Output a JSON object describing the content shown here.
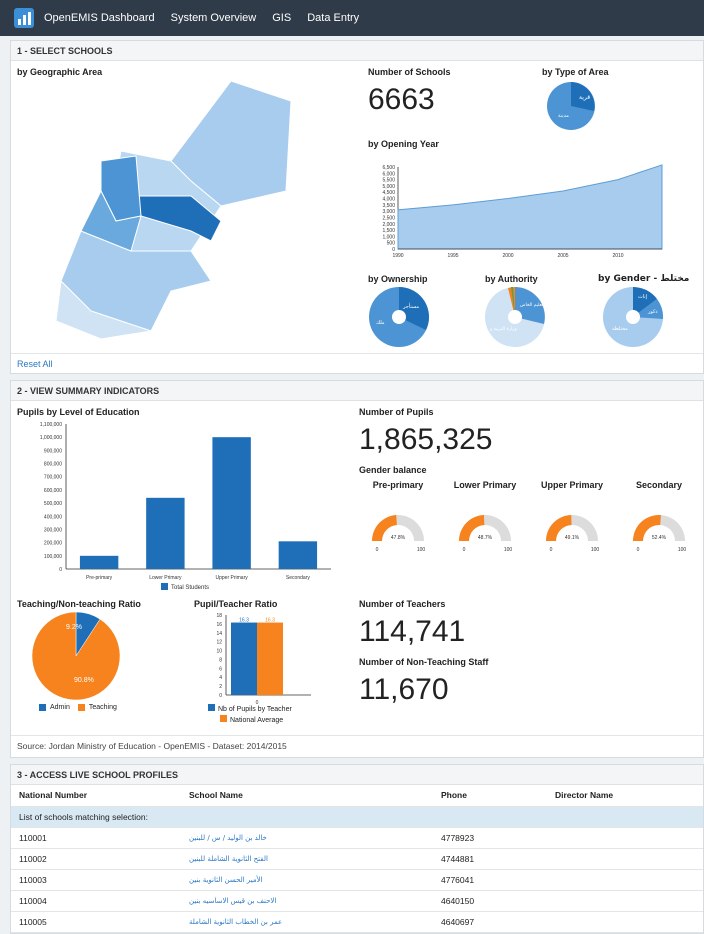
{
  "nav": {
    "brand": "OpenEMIS Dashboard",
    "items": [
      "System Overview",
      "GIS",
      "Data Entry"
    ]
  },
  "section1": {
    "title": "1 - SELECT SCHOOLS",
    "geo_label": "by Geographic Area",
    "schools_label": "Number of Schools",
    "schools_value": "6663",
    "type_area_label": "by Type of Area",
    "type_area_slices": [
      "قرية",
      "مدينة"
    ],
    "opening_year_label": "by Opening Year",
    "ownership_label": "by Ownership",
    "ownership_slices": [
      "مستأجر",
      "ملك"
    ],
    "authority_label": "by Authority",
    "authority_slices": [
      "التعليم الخاص",
      "وزارة التربية و"
    ],
    "gender_label": "by Gender - مختلط",
    "gender_slices": [
      "إناث",
      "ذكور",
      "مختلطة"
    ],
    "reset": "Reset All",
    "colors": {
      "dark": "#1f6fb8",
      "mid": "#4c94d4",
      "light": "#a7ccee",
      "pale": "#cfe3f5"
    }
  },
  "chart_data": [
    {
      "type": "area",
      "x": [
        1990,
        1995,
        2000,
        2005,
        2010,
        2014
      ],
      "values": [
        3100,
        3500,
        4000,
        4600,
        5500,
        6663
      ],
      "ylim": [
        0,
        6500
      ],
      "yticks": [
        "6,500",
        "6,000",
        "5,500",
        "5,000",
        "4,500",
        "4,000",
        "3,500",
        "3,000",
        "2,500",
        "2,000",
        "1,500",
        "1,000",
        "500",
        "0"
      ],
      "xticks": [
        "1990",
        "1995",
        "2000",
        "2005",
        "2010"
      ]
    },
    {
      "type": "bar",
      "title": "Pupils by Level of Education",
      "categories": [
        "Pre-primary",
        "Lower Primary",
        "Upper Primary",
        "Secondary"
      ],
      "values": [
        100000,
        540000,
        1000000,
        210000
      ],
      "ylim": [
        0,
        1100000
      ],
      "yticks": [
        "1,100,000",
        "1,000,000",
        "900,000",
        "800,000",
        "700,000",
        "600,000",
        "500,000",
        "400,000",
        "300,000",
        "200,000",
        "100,000",
        "0"
      ],
      "legend": "Total Students"
    },
    {
      "type": "pie",
      "title": "Teaching/Non-teaching Ratio",
      "labels": [
        "Admin",
        "Teaching"
      ],
      "values": [
        9.2,
        90.8
      ],
      "value_labels": [
        "9.2%",
        "90.8%"
      ]
    },
    {
      "type": "bar",
      "title": "Pupil/Teacher Ratio",
      "categories": [
        "0"
      ],
      "series": [
        {
          "name": "Nb of Pupils by Teacher",
          "values": [
            16.3
          ]
        },
        {
          "name": "National Average",
          "values": [
            16.3
          ]
        }
      ],
      "ylim": [
        0,
        18
      ],
      "yticks": [
        "18",
        "16",
        "14",
        "12",
        "10",
        "8",
        "6",
        "4",
        "2",
        "0"
      ],
      "value_labels": [
        "16.3",
        "16.3"
      ]
    }
  ],
  "section2": {
    "title": "2 - VIEW SUMMARY INDICATORS",
    "pupils_label": "Number of Pupils",
    "pupils_value": "1,865,325",
    "gender_balance_label": "Gender balance",
    "gauges": [
      {
        "label": "Pre-primary",
        "value": 47.8,
        "text": "47.8%"
      },
      {
        "label": "Lower Primary",
        "value": 48.7,
        "text": "48.7%"
      },
      {
        "label": "Upper Primary",
        "value": 49.1,
        "text": "49.1%"
      },
      {
        "label": "Secondary",
        "value": 52.4,
        "text": "52.4%"
      }
    ],
    "gauge_min": "0",
    "gauge_max": "100",
    "teachers_label": "Number of Teachers",
    "teachers_value": "114,741",
    "nonteaching_label": "Number of Non-Teaching Staff",
    "nonteaching_value": "11,670",
    "source": "Source: Jordan Ministry of Education - OpenEMIS - Dataset: 2014/2015",
    "orange": "#f7831e",
    "blue": "#1f6fb8"
  },
  "section3": {
    "title": "3 - ACCESS LIVE SCHOOL PROFILES",
    "columns": [
      "National Number",
      "School Name",
      "Phone",
      "Director Name"
    ],
    "selection_label": "List of schools matching selection:",
    "rows": [
      {
        "num": "110001",
        "name": "خالد بن الوليد / س / للبنين",
        "phone": "4778923",
        "director": ""
      },
      {
        "num": "110002",
        "name": "الفتح الثانوية الشاملة للبنين",
        "phone": "4744881",
        "director": ""
      },
      {
        "num": "110003",
        "name": "الأمير الحسن الثانوية بنين",
        "phone": "4776041",
        "director": ""
      },
      {
        "num": "110004",
        "name": "الاحنف بن قيس الاساسيه بنين",
        "phone": "4640150",
        "director": ""
      },
      {
        "num": "110005",
        "name": "عمر بن الخطاب الثانوية الشاملة",
        "phone": "4640697",
        "director": ""
      }
    ]
  }
}
